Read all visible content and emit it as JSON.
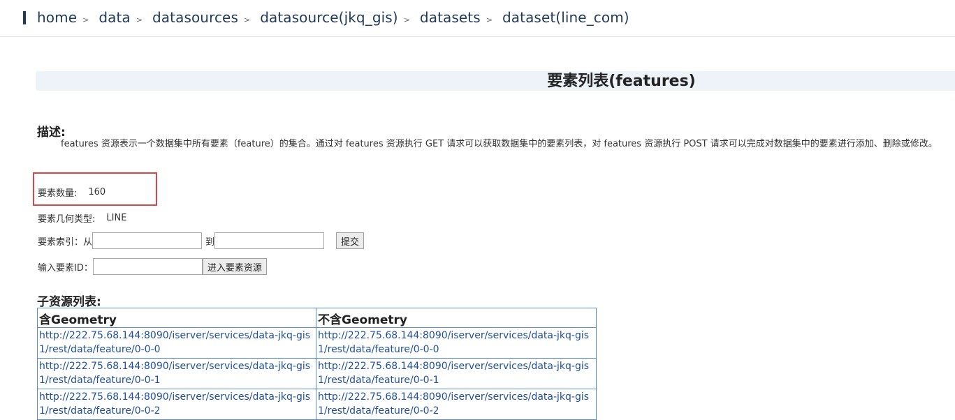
{
  "breadcrumb": {
    "items": [
      "home",
      "data",
      "datasources",
      "datasource(jkq_gis)",
      "datasets",
      "dataset(line_com)"
    ],
    "separator": ">",
    "accent_color": "#1f3a5c"
  },
  "page": {
    "title": "要素列表(features)",
    "title_band_color": "#eef3fa"
  },
  "description": {
    "heading": "描述:",
    "text": "features 资源表示一个数据集中所有要素（feature）的集合。通过对 features 资源执行 GET 请求可以获取数据集中的要素列表，对 features 资源执行 POST 请求可以完成对数据集中的要素进行添加、删除或修改。"
  },
  "feature_count": {
    "label": "要素数量:",
    "value": "160",
    "highlight_color": "#d9464b"
  },
  "geometry_type": {
    "label": "要素几何类型:",
    "value": "LINE"
  },
  "index_form": {
    "label": "要素索引：从",
    "to_label": "到",
    "from_value": "",
    "to_value": "",
    "submit_label": "提交"
  },
  "id_form": {
    "label": "输入要素ID：",
    "id_value": "",
    "enter_label": "进入要素资源"
  },
  "child_resources": {
    "heading": "子资源列表:",
    "columns": [
      "含Geometry",
      "不含Geometry"
    ],
    "rows": [
      [
        "http://222.75.68.144:8090/iserver/services/data-jkq-gis1/rest/data/feature/0-0-0",
        "http://222.75.68.144:8090/iserver/services/data-jkq-gis1/rest/data/feature/0-0-0"
      ],
      [
        "http://222.75.68.144:8090/iserver/services/data-jkq-gis1/rest/data/feature/0-0-1",
        "http://222.75.68.144:8090/iserver/services/data-jkq-gis1/rest/data/feature/0-0-1"
      ],
      [
        "http://222.75.68.144:8090/iserver/services/data-jkq-gis1/rest/data/feature/0-0-2",
        "http://222.75.68.144:8090/iserver/services/data-jkq-gis1/rest/data/feature/0-0-2"
      ]
    ],
    "border_color": "#5b8bd0",
    "link_color": "#1f4f9e"
  }
}
